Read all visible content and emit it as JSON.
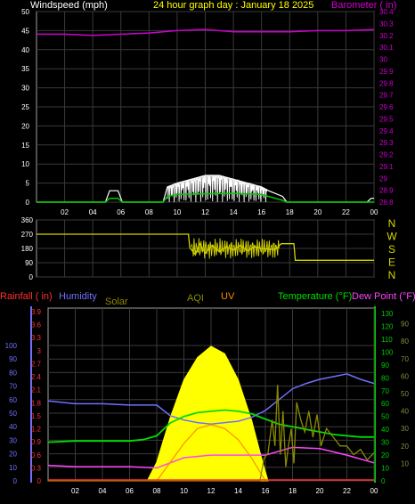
{
  "header": {
    "left": "Windspeed (mph)",
    "center": "24 hour graph day : January 18 2025",
    "right": "Barometer ( in)"
  },
  "colors": {
    "background": "#000000",
    "grid": "#3a3a3a",
    "wind_gust": "#ffffff",
    "wind_avg": "#00cc00",
    "barometer": "#cc00cc",
    "direction": "#d4d400",
    "rain": "#ff3030",
    "humidity": "#7070ff",
    "solar": "#ffff00",
    "aqi": "#8a8a00",
    "uv": "#ff8c00",
    "temperature": "#00dd00",
    "dewpoint": "#ff44ff",
    "header_center": "#ffff00",
    "green_axis": "#00cc00",
    "aqi_axis": "#8a8a40"
  },
  "chart_data": [
    {
      "id": "wind",
      "type": "line",
      "title": "24 hour graph day : January 18 2025",
      "xlabel": "",
      "ylabel": "Windspeed (mph)",
      "y2label": "Barometer ( in)",
      "x_ticks": [
        "02",
        "04",
        "06",
        "08",
        "10",
        "12",
        "14",
        "16",
        "18",
        "20",
        "22",
        "00"
      ],
      "ylim": [
        0,
        50
      ],
      "y_ticks": [
        "0",
        "5",
        "10",
        "15",
        "20",
        "25",
        "30",
        "35",
        "40",
        "45",
        "50"
      ],
      "y2lim": [
        28.8,
        30.4
      ],
      "y2_ticks": [
        "28.8",
        "28.9",
        "29",
        "29.1",
        "29.2",
        "29.3",
        "29.4",
        "29.5",
        "29.6",
        "29.7",
        "29.8",
        "29.9",
        "30",
        "30.1",
        "30.2",
        "30.3",
        "30.4"
      ],
      "grid": true,
      "series": [
        {
          "name": "Barometer",
          "x": [
            0,
            2,
            4,
            6,
            8,
            10,
            12,
            14,
            16,
            18,
            20,
            22,
            24
          ],
          "y": [
            30.21,
            30.21,
            30.2,
            30.21,
            30.22,
            30.24,
            30.25,
            30.23,
            30.23,
            30.23,
            30.24,
            30.24,
            30.25
          ]
        },
        {
          "name": "Gust",
          "x": [
            0,
            4.9,
            5.2,
            5.8,
            6.1,
            9,
            9.3,
            10,
            11,
            12,
            13,
            14,
            15,
            16,
            16.5,
            17.5,
            17.8,
            18.2,
            23.5,
            23.8,
            24
          ],
          "y": [
            0,
            0,
            3,
            3,
            0,
            0,
            4,
            5,
            6,
            7,
            7,
            6,
            5,
            4,
            3,
            1.5,
            0,
            0,
            0,
            1,
            1
          ]
        },
        {
          "name": "Average",
          "x": [
            0,
            4.9,
            5.2,
            5.8,
            6.1,
            9,
            9.3,
            10,
            12,
            14,
            16,
            16.5,
            17.5,
            17.8,
            24
          ],
          "y": [
            0,
            0,
            1,
            1,
            0,
            0,
            1.5,
            2,
            2.2,
            2.3,
            2,
            1.5,
            0.5,
            0,
            0
          ]
        }
      ]
    },
    {
      "id": "direction",
      "type": "line",
      "ylim": [
        0,
        360
      ],
      "y_ticks": [
        "0",
        "90",
        "180",
        "270",
        "360"
      ],
      "right_labels": [
        "N",
        "W",
        "S",
        "E",
        "N"
      ],
      "series": [
        {
          "name": "Wind direction",
          "x": [
            0,
            10.8,
            10.9,
            11.3,
            11.6,
            12,
            12.5,
            13,
            13.5,
            14,
            14.5,
            15,
            15.5,
            16,
            16.5,
            17,
            17.4,
            18.3,
            18.4,
            24
          ],
          "y": [
            270,
            270,
            185,
            140,
            210,
            150,
            200,
            160,
            190,
            170,
            200,
            165,
            190,
            180,
            175,
            175,
            210,
            210,
            105,
            105
          ]
        }
      ]
    },
    {
      "id": "multi",
      "type": "line",
      "labels": {
        "rain": "Rainfall ( in)",
        "humidity": "Humidity",
        "solar": "Solar",
        "aqi": "AQI",
        "uv": "UV",
        "temperature": "Temperature (°F)",
        "dewpoint": "Dew Point (°F)"
      },
      "x_ticks": [
        "02",
        "04",
        "06",
        "08",
        "10",
        "12",
        "14",
        "16",
        "18",
        "20",
        "22",
        "00"
      ],
      "humidity_ticks": [
        "0",
        "10",
        "20",
        "30",
        "40",
        "50",
        "60",
        "70",
        "80",
        "90",
        "100"
      ],
      "rain_ticks": [
        "0",
        "0.3",
        "0.6",
        "0.9",
        "1.2",
        "1.5",
        "1.8",
        "2.1",
        "2.4",
        "2.7",
        "3",
        "3.3",
        "3.6",
        "3.9"
      ],
      "temp_ticks": [
        "0",
        "10",
        "20",
        "30",
        "40",
        "50",
        "60",
        "70",
        "80",
        "90",
        "100",
        "110",
        "120",
        "130"
      ],
      "aqi_ticks": [
        "10",
        "20",
        "30",
        "40",
        "50",
        "60",
        "70",
        "80",
        "90"
      ],
      "humidity_range": [
        0,
        100
      ],
      "temp_range": [
        0,
        130
      ],
      "series": [
        {
          "name": "Humidity",
          "x": [
            0,
            2,
            4,
            6,
            7,
            8,
            9,
            10,
            11,
            12,
            13,
            14,
            15,
            16,
            17,
            18,
            19,
            20,
            21,
            22,
            23,
            24
          ],
          "y": [
            59,
            57,
            57,
            56,
            56,
            56,
            48,
            45,
            43,
            42,
            43,
            44,
            47,
            52,
            60,
            68,
            72,
            75,
            77,
            79,
            75,
            72
          ]
        },
        {
          "name": "Temperature",
          "x": [
            0,
            2,
            4,
            6,
            7,
            8,
            9,
            10,
            11,
            12,
            13,
            14,
            15,
            16,
            17,
            18,
            19,
            20,
            21,
            22,
            23,
            24
          ],
          "y": [
            30,
            31,
            31,
            31,
            32,
            35,
            45,
            50,
            53,
            54,
            55,
            54,
            52,
            48,
            44,
            42,
            40,
            38,
            36,
            35,
            34,
            34
          ]
        },
        {
          "name": "Dew Point",
          "x": [
            0,
            2,
            4,
            6,
            8,
            10,
            12,
            14,
            16,
            18,
            20,
            22,
            24
          ],
          "y": [
            12,
            11,
            11,
            11,
            10,
            18,
            20,
            20,
            20,
            26,
            25,
            20,
            14
          ]
        },
        {
          "name": "Solar",
          "x": [
            7.3,
            8,
            9,
            10,
            11,
            12,
            13,
            14,
            15,
            15.8,
            16.2
          ],
          "y": [
            0,
            5,
            17,
            27,
            33,
            36,
            34,
            27,
            16,
            5,
            0
          ]
        },
        {
          "name": "UV",
          "x": [
            8,
            9,
            10,
            11,
            12,
            13,
            14,
            15,
            16
          ],
          "y": [
            0,
            5,
            10,
            14,
            15,
            14,
            11,
            6,
            0
          ]
        },
        {
          "name": "AQI",
          "x": [
            0,
            15.6,
            15.9,
            16.2,
            16.5,
            16.7,
            16.9,
            17.1,
            17.3,
            17.5,
            17.7,
            17.9,
            18.1,
            18.3,
            18.6,
            18.9,
            19.2,
            19.5,
            19.8,
            20.1,
            20.5,
            21,
            21.5,
            22,
            22.5,
            23,
            23.5,
            24
          ],
          "y": [
            0,
            0,
            13,
            16,
            35,
            20,
            55,
            15,
            40,
            8,
            20,
            30,
            10,
            45,
            35,
            28,
            40,
            25,
            38,
            20,
            30,
            25,
            20,
            20,
            15,
            18,
            12,
            16
          ]
        },
        {
          "name": "Rainfall",
          "x": [
            0,
            24
          ],
          "y": [
            0,
            0
          ]
        }
      ]
    }
  ]
}
